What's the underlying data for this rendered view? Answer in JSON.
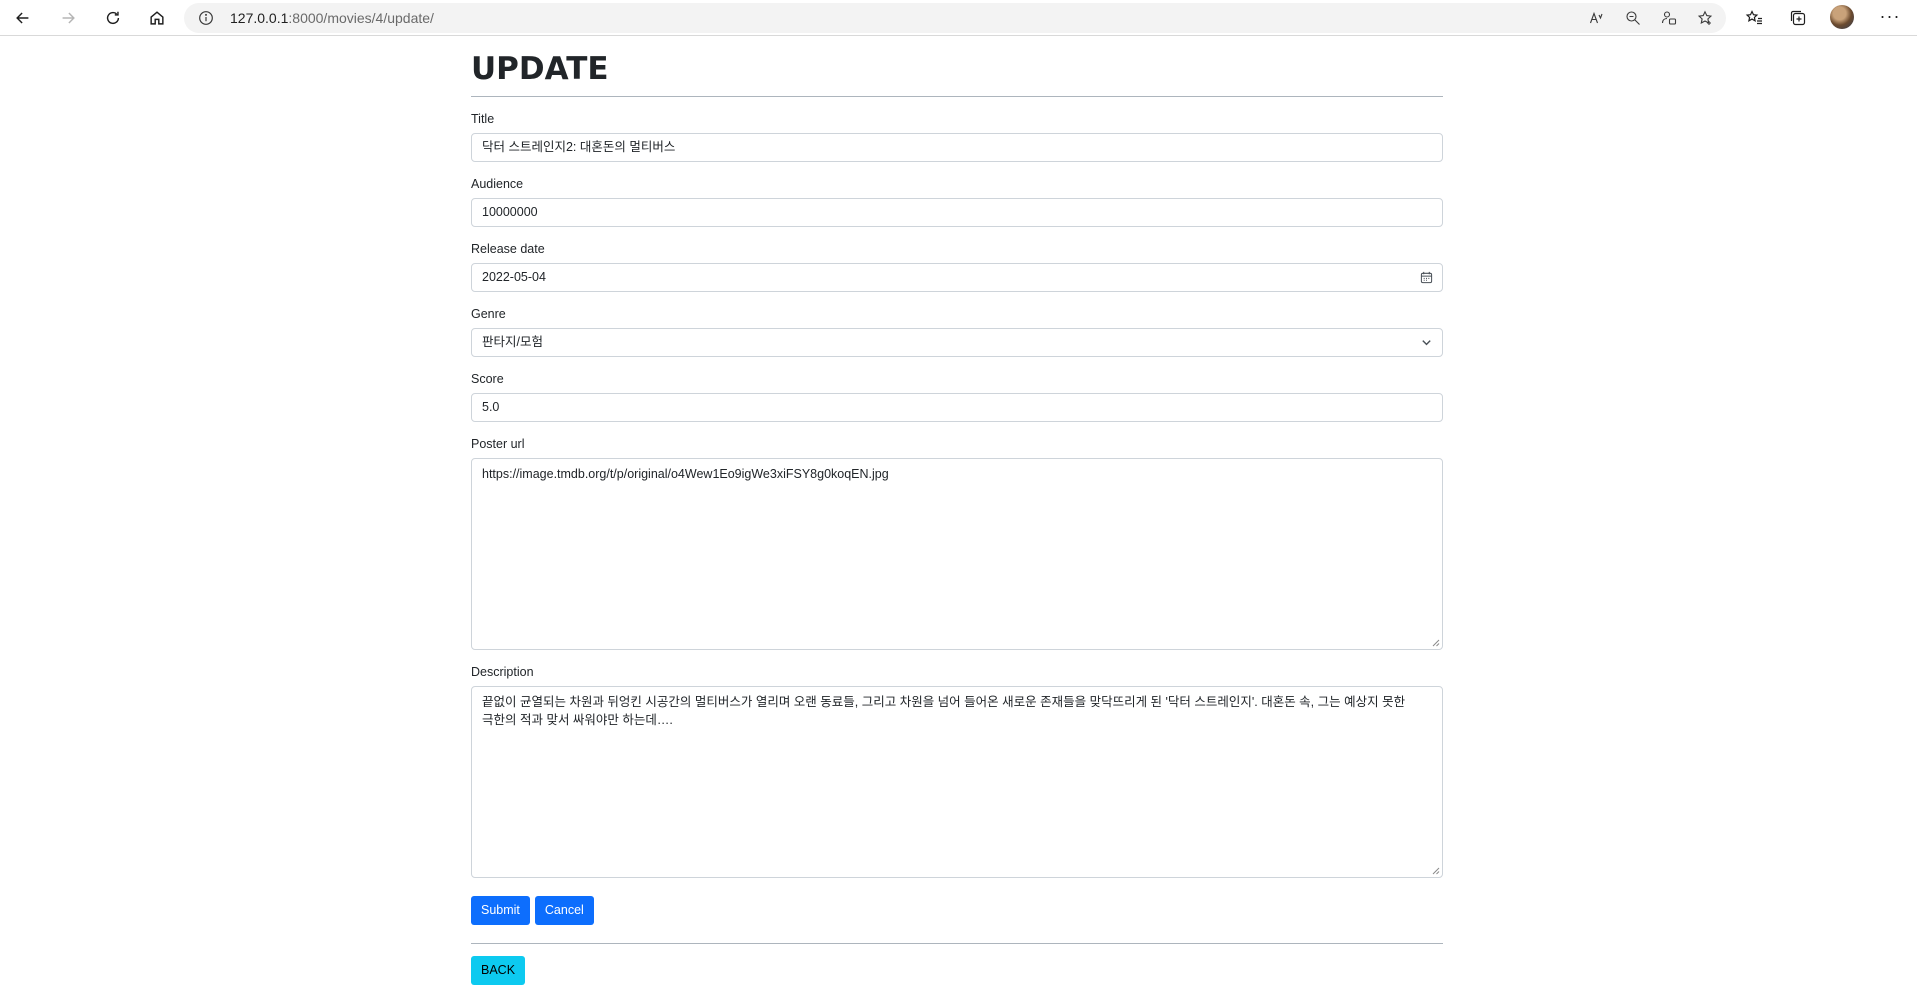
{
  "browser": {
    "url_host": "127.0.0.1",
    "url_path": ":8000/movies/4/update/"
  },
  "page": {
    "title": "UPDATE"
  },
  "form": {
    "title": {
      "label": "Title",
      "value": "닥터 스트레인지2: 대혼돈의 멀티버스"
    },
    "audience": {
      "label": "Audience",
      "value": "10000000"
    },
    "release_date": {
      "label": "Release date",
      "value": "2022-05-04"
    },
    "genre": {
      "label": "Genre",
      "value": "판타지/모험"
    },
    "score": {
      "label": "Score",
      "value": "5.0"
    },
    "poster_url": {
      "label": "Poster url",
      "value": "https://image.tmdb.org/t/p/original/o4Wew1Eo9igWe3xiFSY8g0koqEN.jpg"
    },
    "description": {
      "label": "Description",
      "value": "끝없이 균열되는 차원과 뒤엉킨 시공간의 멀티버스가 열리며 오랜 동료들, 그리고 차원을 넘어 들어온 새로운 존재들을 맞닥뜨리게 된 '닥터 스트레인지'. 대혼돈 속, 그는 예상지 못한 극한의 적과 맞서 싸워야만 하는데…."
    },
    "submit_label": "Submit",
    "cancel_label": "Cancel"
  },
  "back_label": "BACK",
  "colors": {
    "primary": "#0d6efd",
    "info": "#0dcaf0",
    "border": "#ced4da"
  },
  "icons": {
    "date_picker": "calendar-icon",
    "select": "chevron-down-icon"
  }
}
